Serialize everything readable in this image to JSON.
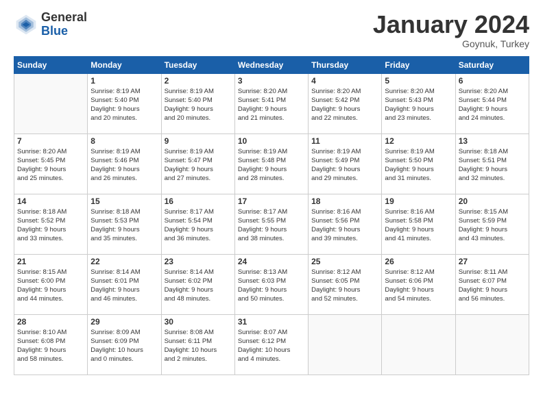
{
  "logo": {
    "general": "General",
    "blue": "Blue"
  },
  "title": "January 2024",
  "location": "Goynuk, Turkey",
  "weekdays": [
    "Sunday",
    "Monday",
    "Tuesday",
    "Wednesday",
    "Thursday",
    "Friday",
    "Saturday"
  ],
  "weeks": [
    [
      {
        "num": "",
        "info": ""
      },
      {
        "num": "1",
        "info": "Sunrise: 8:19 AM\nSunset: 5:40 PM\nDaylight: 9 hours\nand 20 minutes."
      },
      {
        "num": "2",
        "info": "Sunrise: 8:19 AM\nSunset: 5:40 PM\nDaylight: 9 hours\nand 20 minutes."
      },
      {
        "num": "3",
        "info": "Sunrise: 8:20 AM\nSunset: 5:41 PM\nDaylight: 9 hours\nand 21 minutes."
      },
      {
        "num": "4",
        "info": "Sunrise: 8:20 AM\nSunset: 5:42 PM\nDaylight: 9 hours\nand 22 minutes."
      },
      {
        "num": "5",
        "info": "Sunrise: 8:20 AM\nSunset: 5:43 PM\nDaylight: 9 hours\nand 23 minutes."
      },
      {
        "num": "6",
        "info": "Sunrise: 8:20 AM\nSunset: 5:44 PM\nDaylight: 9 hours\nand 24 minutes."
      }
    ],
    [
      {
        "num": "7",
        "info": "Sunrise: 8:20 AM\nSunset: 5:45 PM\nDaylight: 9 hours\nand 25 minutes."
      },
      {
        "num": "8",
        "info": "Sunrise: 8:19 AM\nSunset: 5:46 PM\nDaylight: 9 hours\nand 26 minutes."
      },
      {
        "num": "9",
        "info": "Sunrise: 8:19 AM\nSunset: 5:47 PM\nDaylight: 9 hours\nand 27 minutes."
      },
      {
        "num": "10",
        "info": "Sunrise: 8:19 AM\nSunset: 5:48 PM\nDaylight: 9 hours\nand 28 minutes."
      },
      {
        "num": "11",
        "info": "Sunrise: 8:19 AM\nSunset: 5:49 PM\nDaylight: 9 hours\nand 29 minutes."
      },
      {
        "num": "12",
        "info": "Sunrise: 8:19 AM\nSunset: 5:50 PM\nDaylight: 9 hours\nand 31 minutes."
      },
      {
        "num": "13",
        "info": "Sunrise: 8:18 AM\nSunset: 5:51 PM\nDaylight: 9 hours\nand 32 minutes."
      }
    ],
    [
      {
        "num": "14",
        "info": "Sunrise: 8:18 AM\nSunset: 5:52 PM\nDaylight: 9 hours\nand 33 minutes."
      },
      {
        "num": "15",
        "info": "Sunrise: 8:18 AM\nSunset: 5:53 PM\nDaylight: 9 hours\nand 35 minutes."
      },
      {
        "num": "16",
        "info": "Sunrise: 8:17 AM\nSunset: 5:54 PM\nDaylight: 9 hours\nand 36 minutes."
      },
      {
        "num": "17",
        "info": "Sunrise: 8:17 AM\nSunset: 5:55 PM\nDaylight: 9 hours\nand 38 minutes."
      },
      {
        "num": "18",
        "info": "Sunrise: 8:16 AM\nSunset: 5:56 PM\nDaylight: 9 hours\nand 39 minutes."
      },
      {
        "num": "19",
        "info": "Sunrise: 8:16 AM\nSunset: 5:58 PM\nDaylight: 9 hours\nand 41 minutes."
      },
      {
        "num": "20",
        "info": "Sunrise: 8:15 AM\nSunset: 5:59 PM\nDaylight: 9 hours\nand 43 minutes."
      }
    ],
    [
      {
        "num": "21",
        "info": "Sunrise: 8:15 AM\nSunset: 6:00 PM\nDaylight: 9 hours\nand 44 minutes."
      },
      {
        "num": "22",
        "info": "Sunrise: 8:14 AM\nSunset: 6:01 PM\nDaylight: 9 hours\nand 46 minutes."
      },
      {
        "num": "23",
        "info": "Sunrise: 8:14 AM\nSunset: 6:02 PM\nDaylight: 9 hours\nand 48 minutes."
      },
      {
        "num": "24",
        "info": "Sunrise: 8:13 AM\nSunset: 6:03 PM\nDaylight: 9 hours\nand 50 minutes."
      },
      {
        "num": "25",
        "info": "Sunrise: 8:12 AM\nSunset: 6:05 PM\nDaylight: 9 hours\nand 52 minutes."
      },
      {
        "num": "26",
        "info": "Sunrise: 8:12 AM\nSunset: 6:06 PM\nDaylight: 9 hours\nand 54 minutes."
      },
      {
        "num": "27",
        "info": "Sunrise: 8:11 AM\nSunset: 6:07 PM\nDaylight: 9 hours\nand 56 minutes."
      }
    ],
    [
      {
        "num": "28",
        "info": "Sunrise: 8:10 AM\nSunset: 6:08 PM\nDaylight: 9 hours\nand 58 minutes."
      },
      {
        "num": "29",
        "info": "Sunrise: 8:09 AM\nSunset: 6:09 PM\nDaylight: 10 hours\nand 0 minutes."
      },
      {
        "num": "30",
        "info": "Sunrise: 8:08 AM\nSunset: 6:11 PM\nDaylight: 10 hours\nand 2 minutes."
      },
      {
        "num": "31",
        "info": "Sunrise: 8:07 AM\nSunset: 6:12 PM\nDaylight: 10 hours\nand 4 minutes."
      },
      {
        "num": "",
        "info": ""
      },
      {
        "num": "",
        "info": ""
      },
      {
        "num": "",
        "info": ""
      }
    ]
  ]
}
